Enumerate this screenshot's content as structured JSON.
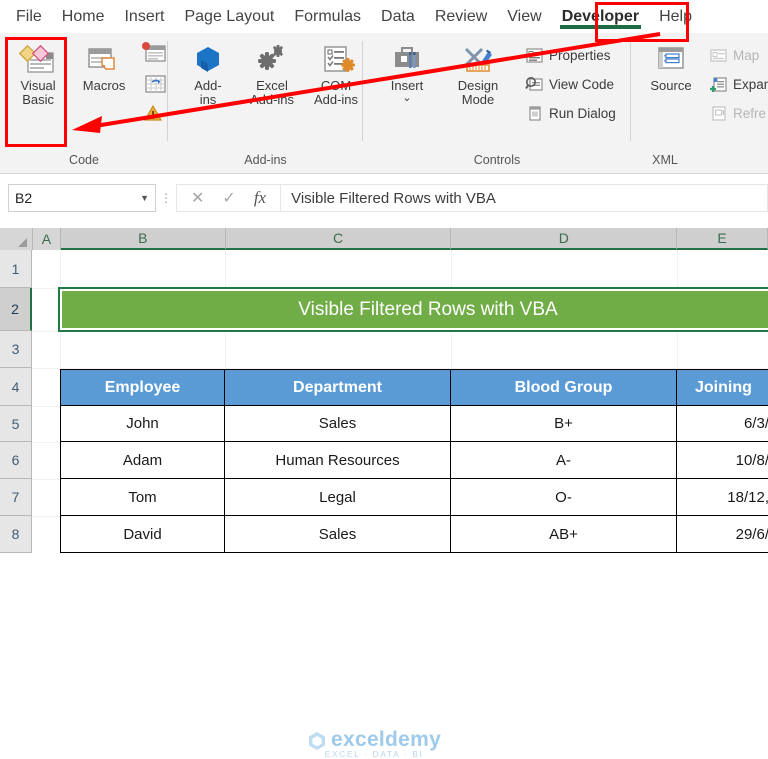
{
  "ribbon": {
    "tabs": [
      {
        "label": "File",
        "active": false
      },
      {
        "label": "Home",
        "active": false
      },
      {
        "label": "Insert",
        "active": false
      },
      {
        "label": "Page Layout",
        "active": false
      },
      {
        "label": "Formulas",
        "active": false
      },
      {
        "label": "Data",
        "active": false
      },
      {
        "label": "Review",
        "active": false
      },
      {
        "label": "View",
        "active": false
      },
      {
        "label": "Developer",
        "active": true
      },
      {
        "label": "Help",
        "active": false
      }
    ],
    "groups": {
      "code": {
        "label": "Code",
        "visual_basic": "Visual Basic",
        "visual_basic_line1": "Visual",
        "visual_basic_line2": "Basic",
        "macros": "Macros",
        "record_macro_icon": "record-macro-icon",
        "use_relative_references_icon": "use-relative-references-icon",
        "macro_security_icon": "macro-security-icon"
      },
      "addins": {
        "label": "Add-ins",
        "addins_line1": "Add-",
        "addins_line2": "ins",
        "excel_addins_line1": "Excel",
        "excel_addins_line2": "Add-ins",
        "com_addins_line1": "COM",
        "com_addins_line2": "Add-ins"
      },
      "controls": {
        "label": "Controls",
        "insert": "Insert",
        "insert_caret": "⌄",
        "design_line1": "Design",
        "design_line2": "Mode",
        "properties": "Properties",
        "view_code": "View Code",
        "run_dialog": "Run Dialog"
      },
      "xml": {
        "label": "XML",
        "source": "Source",
        "map": "Map",
        "expansion": "Expan",
        "refresh": "Refre"
      }
    }
  },
  "formula_bar": {
    "name_box_value": "B2",
    "name_box_caret": "▼",
    "cancel_icon": "✕",
    "enter_icon": "✓",
    "function_icon": "fx",
    "formula_value": "Visible Filtered Rows with VBA"
  },
  "grid": {
    "column_headers": [
      {
        "label": "A",
        "selected": false
      },
      {
        "label": "B",
        "selected": true
      },
      {
        "label": "C",
        "selected": true
      },
      {
        "label": "D",
        "selected": true
      },
      {
        "label": "E",
        "selected": true
      }
    ],
    "row_headers": [
      {
        "label": "1",
        "selected": false
      },
      {
        "label": "2",
        "selected": true
      },
      {
        "label": "3",
        "selected": false
      },
      {
        "label": "4",
        "selected": false
      },
      {
        "label": "5",
        "selected": false
      },
      {
        "label": "6",
        "selected": false
      },
      {
        "label": "7",
        "selected": false
      },
      {
        "label": "8",
        "selected": false
      }
    ],
    "title_cell": "Visible Filtered Rows with VBA",
    "table_headers": [
      "Employee",
      "Department",
      "Blood Group",
      "Joining"
    ],
    "table_rows": [
      {
        "employee": "John",
        "department": "Sales",
        "blood_group": "B+",
        "joining_date": "6/3/"
      },
      {
        "employee": "Adam",
        "department": "Human Resources",
        "blood_group": "A-",
        "joining_date": "10/8/"
      },
      {
        "employee": "Tom",
        "department": "Legal",
        "blood_group": "O-",
        "joining_date": "18/12,"
      },
      {
        "employee": "David",
        "department": "Sales",
        "blood_group": "AB+",
        "joining_date": "29/6/"
      }
    ]
  },
  "watermark": {
    "name": "exceldemy",
    "tagline": "EXCEL · DATA · BI"
  },
  "annotations": {
    "accent_red": "#ff0000",
    "developer_tab_highlight": "developer-tab-highlight",
    "visual_basic_highlight": "visual-basic-highlight",
    "arrow": "red-arrow-developer-to-visual-basic"
  },
  "colors": {
    "title_green": "#70AD47",
    "header_blue": "#5B9BD5",
    "tab_underline_green": "#1e6b41"
  }
}
